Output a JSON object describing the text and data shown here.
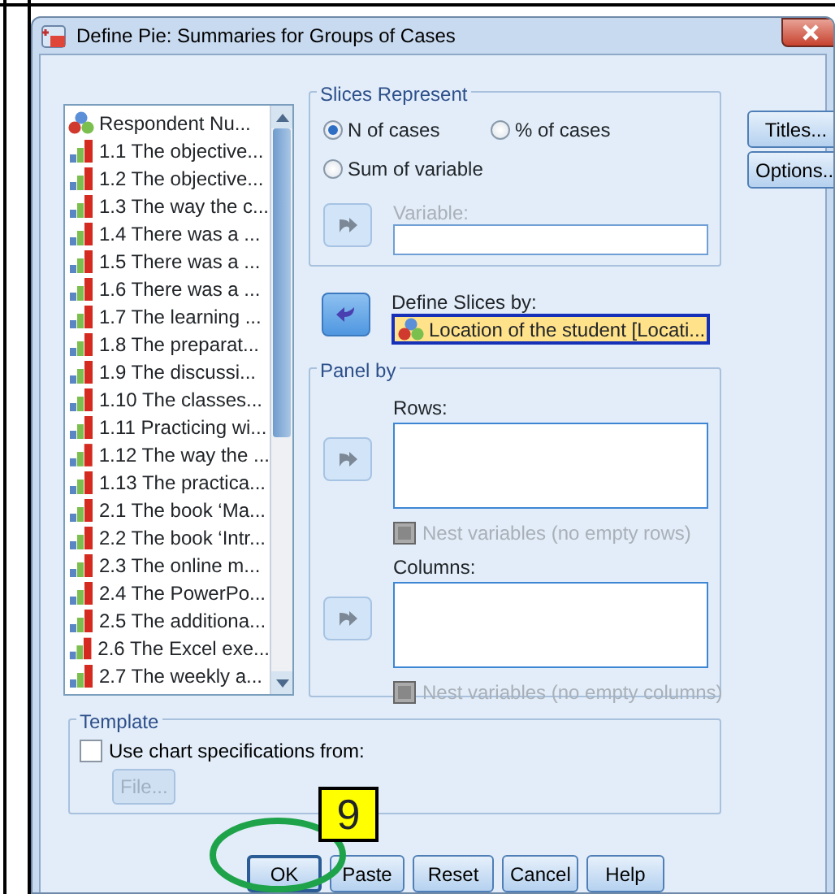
{
  "window": {
    "title": "Define Pie: Summaries for Groups of Cases"
  },
  "variables": {
    "items": [
      {
        "label": "Respondent Nu...",
        "kind": "nominal",
        "selected": false
      },
      {
        "label": "1.1 The objective...",
        "kind": "ordinal",
        "selected": false
      },
      {
        "label": "1.2 The objective...",
        "kind": "ordinal",
        "selected": false
      },
      {
        "label": "1.3 The way the c...",
        "kind": "ordinal",
        "selected": false
      },
      {
        "label": "1.4 There was a ...",
        "kind": "ordinal",
        "selected": false
      },
      {
        "label": "1.5 There was a ...",
        "kind": "ordinal",
        "selected": false
      },
      {
        "label": "1.6 There was a ...",
        "kind": "ordinal",
        "selected": false
      },
      {
        "label": "1.7 The learning ...",
        "kind": "ordinal",
        "selected": false
      },
      {
        "label": "1.8 The preparat...",
        "kind": "ordinal",
        "selected": false
      },
      {
        "label": "1.9 The discussi...",
        "kind": "ordinal",
        "selected": false
      },
      {
        "label": "1.10 The classes...",
        "kind": "ordinal",
        "selected": false
      },
      {
        "label": "1.11 Practicing wi...",
        "kind": "ordinal",
        "selected": false
      },
      {
        "label": "1.12 The way the ...",
        "kind": "ordinal",
        "selected": false
      },
      {
        "label": "1.13 The practica...",
        "kind": "ordinal",
        "selected": false
      },
      {
        "label": "2.1 The book ‘Ma...",
        "kind": "ordinal",
        "selected": false
      },
      {
        "label": "2.2 The book ‘Intr...",
        "kind": "ordinal",
        "selected": false
      },
      {
        "label": "2.3 The online m...",
        "kind": "ordinal",
        "selected": false
      },
      {
        "label": "2.4 The PowerPo...",
        "kind": "ordinal",
        "selected": false
      },
      {
        "label": "2.5 The additiona...",
        "kind": "ordinal",
        "selected": false
      },
      {
        "label": "2.6 The Excel exe...",
        "kind": "ordinal",
        "selected": false
      },
      {
        "label": "2.7 The weekly a...",
        "kind": "ordinal",
        "selected": false
      }
    ]
  },
  "slices_represent": {
    "title": "Slices Represent",
    "options": [
      {
        "label": "N of cases",
        "selected": true
      },
      {
        "label": "% of cases",
        "selected": false
      },
      {
        "label": "Sum of variable",
        "selected": false
      }
    ],
    "variable": {
      "label": "Variable:",
      "disabled": true,
      "arrow": {
        "kind": "right",
        "disabled": true
      }
    }
  },
  "define_slices": {
    "label": "Define Slices by:",
    "value": "Location of the student [Locati...",
    "kind": "nominal",
    "arrow": {
      "kind": "left",
      "disabled": false
    }
  },
  "panel_by": {
    "title": "Panel by",
    "fields": [
      {
        "label": "Rows:",
        "arrow": {
          "kind": "right",
          "disabled": true
        },
        "nest_label": "Nest variables (no empty rows)",
        "nest_checked": false,
        "nest_disabled": true
      },
      {
        "label": "Columns:",
        "arrow": {
          "kind": "right",
          "disabled": true
        },
        "nest_label": "Nest variables (no empty columns)",
        "nest_checked": false,
        "nest_disabled": true
      }
    ]
  },
  "side_buttons": [
    "Titles...",
    "Options..."
  ],
  "template": {
    "title": "Template",
    "checkbox_label": "Use chart specifications from:",
    "checked": false,
    "file_button": "File...",
    "file_disabled": true
  },
  "buttons": [
    {
      "label": "OK",
      "default": true
    },
    {
      "label": "Paste",
      "default": false
    },
    {
      "label": "Reset",
      "default": false
    },
    {
      "label": "Cancel",
      "default": false
    },
    {
      "label": "Help",
      "default": false
    }
  ],
  "annotation": {
    "label": "9"
  }
}
